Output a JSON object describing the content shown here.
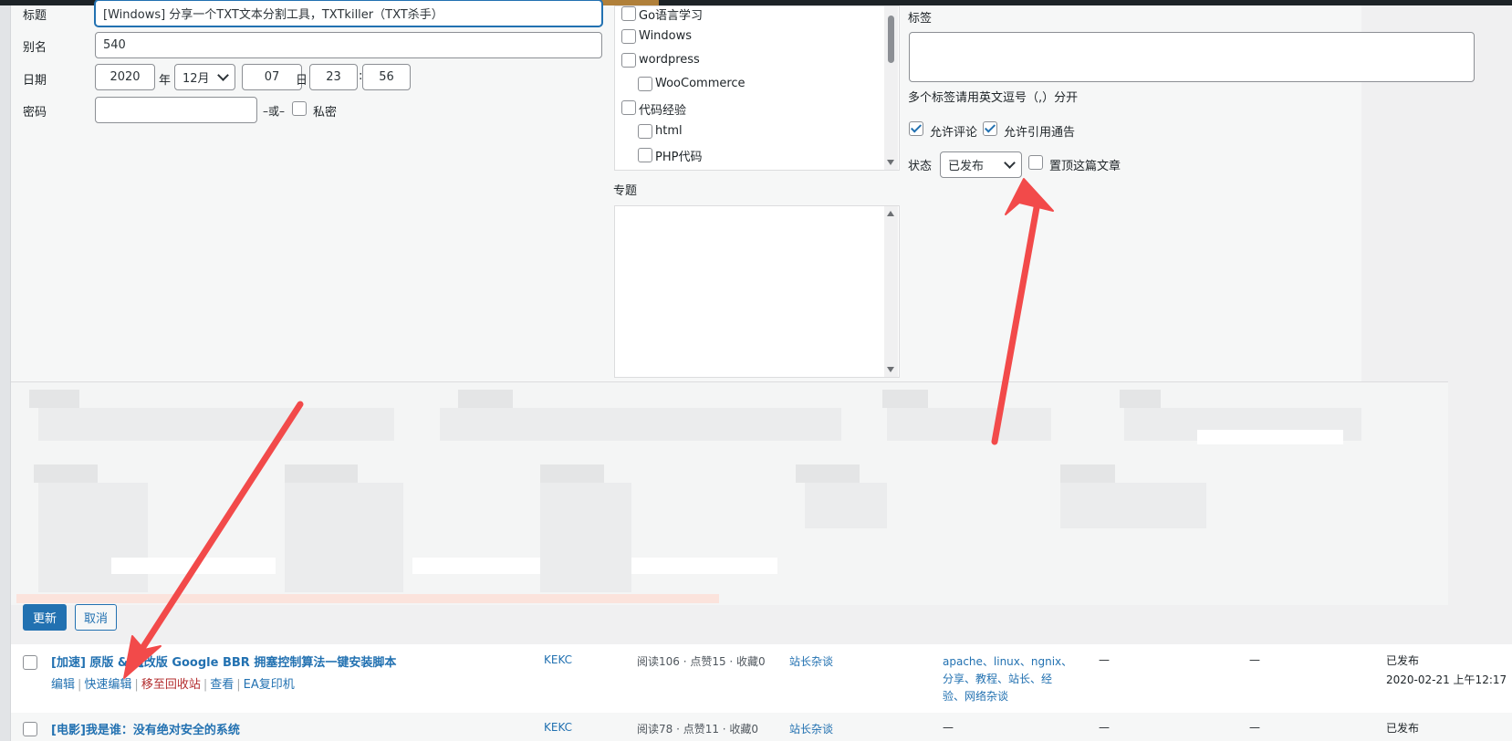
{
  "quick_edit": {
    "title_label": "标题",
    "title_value": "[Windows] 分享一个TXT文本分割工具，TXTkiller（TXT杀手）",
    "slug_label": "别名",
    "slug_value": "540",
    "date_label": "日期",
    "year_value": "2020",
    "year_unit": "年",
    "month_value": "12月",
    "day_value": "07",
    "day_unit": "日",
    "hour_value": "23",
    "colon": ":",
    "minute_value": "56",
    "password_label": "密码",
    "password_value": "",
    "or_text": "–或–",
    "private_label": "私密"
  },
  "categories": {
    "items": [
      {
        "label": "Go语言学习",
        "checked": false
      },
      {
        "label": "Windows",
        "checked": false
      },
      {
        "label": "wordpress",
        "checked": false
      },
      {
        "label": "WooCommerce",
        "checked": false
      },
      {
        "label": "代码经验",
        "checked": false
      },
      {
        "label": "html",
        "checked": false
      },
      {
        "label": "PHP代码",
        "checked": false
      }
    ]
  },
  "topics": {
    "label": "专题"
  },
  "tags": {
    "label": "标签",
    "value": "",
    "hint": "多个标签请用英文逗号（,）分开"
  },
  "options": {
    "allow_comments_label": "允许评论",
    "allow_pings_label": "允许引用通告",
    "status_label": "状态",
    "status_value": "已发布",
    "sticky_label": "置顶这篇文章"
  },
  "buttons": {
    "update": "更新",
    "cancel": "取消"
  },
  "posts": [
    {
      "title": "[加速] 原版 & 魔改版 Google BBR 拥塞控制算法一键安装脚本",
      "author": "KEKC",
      "stats": "阅读106 · 点赞15 · 收藏0",
      "category": "站长杂谈",
      "tags_line1": "apache、linux、ngnix、",
      "tags_line2": "分享、教程、站长、经",
      "tags_line3": "验、网络杂谈",
      "col1": "—",
      "col2": "—",
      "status": "已发布",
      "date": "2020-02-21 上午12:17",
      "actions": {
        "edit": "编辑",
        "quick_edit": "快速编辑",
        "trash": "移至回收站",
        "view": "查看",
        "copy": "EA复印机"
      }
    },
    {
      "title": "[电影]我是谁：没有绝对安全的系统",
      "author": "KEKC",
      "stats": "阅读78 · 点赞11 · 收藏0",
      "category": "站长杂谈",
      "tags_line1": "—",
      "col1": "—",
      "col2": "—",
      "status": "已发布"
    }
  ],
  "colors": {
    "accent": "#2271b1",
    "annotation_arrow": "#f24a4a",
    "trash": "#b32d2e"
  }
}
